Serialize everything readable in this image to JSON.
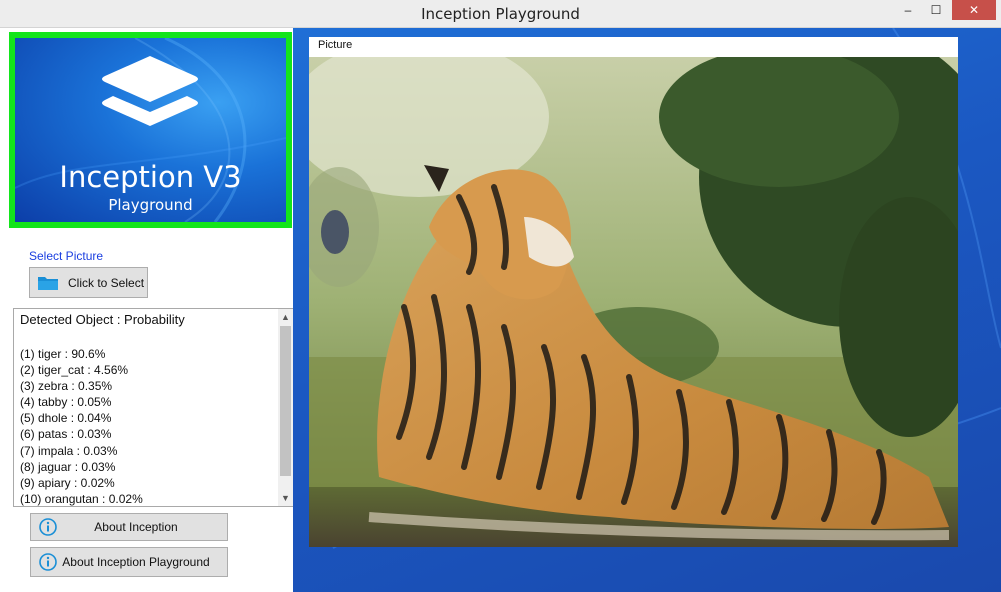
{
  "window": {
    "title": "Inception Playground"
  },
  "titlebar_buttons": {
    "minimize": "‒",
    "maximize": "☐",
    "close": "✕"
  },
  "logo": {
    "title": "Inception V3",
    "subtitle": "Playground"
  },
  "select_picture": {
    "label": "Select Picture",
    "button": "Click to Select"
  },
  "results": {
    "header": "Detected Object : Probability",
    "items": [
      "(1) tiger : 90.6%",
      "(2) tiger_cat : 4.56%",
      "(3) zebra : 0.35%",
      "(4) tabby : 0.05%",
      "(5) dhole : 0.04%",
      "(6) patas : 0.03%",
      "(7) impala : 0.03%",
      "(8) jaguar : 0.03%",
      "(9) apiary : 0.02%",
      "(10) orangutan : 0.02%"
    ]
  },
  "buttons": {
    "about_inception": "About Inception",
    "about_playground": "About Inception Playground"
  },
  "picture": {
    "label": "Picture"
  },
  "colors": {
    "accent_green": "#13e51b",
    "link_blue": "#1a3ee0",
    "desktop_blue": "#1b58c2"
  },
  "icons": [
    "folder-icon",
    "info-icon",
    "layers-icon"
  ]
}
